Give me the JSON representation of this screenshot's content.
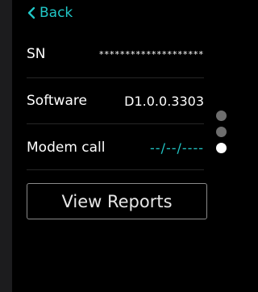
{
  "nav": {
    "back_label": "Back",
    "back_icon": "chevron-left-icon"
  },
  "info": {
    "sn_label": "SN",
    "sn_value": "********************",
    "software_label": "Software",
    "software_value": "D1.0.0.3303",
    "modem_label": "Modem call",
    "modem_value": "--/--/----"
  },
  "pager": {
    "pages": 3,
    "active_page": 3
  },
  "actions": {
    "view_reports_label": "View Reports"
  },
  "colors": {
    "accent": "#21c7c7",
    "background": "#000000",
    "side_strip": "#1c1c1e",
    "dot_inactive": "#6e6e6e",
    "dot_active": "#ffffff"
  }
}
